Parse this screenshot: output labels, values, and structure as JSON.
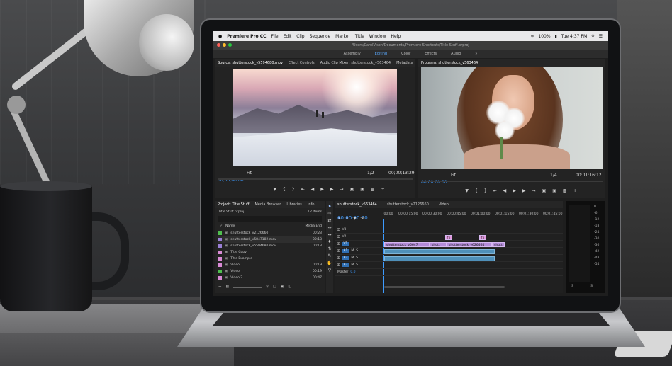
{
  "menubar": {
    "app_name": "Premiere Pro CC",
    "items": [
      "File",
      "Edit",
      "Clip",
      "Sequence",
      "Marker",
      "Title",
      "Window",
      "Help"
    ],
    "battery": "100%",
    "clock": "Tue 4:37 PM"
  },
  "window": {
    "path": "/Users/CarolVison/Documents/Premiere Shortcuts/Title Stuff.prproj"
  },
  "workspaces": {
    "items": [
      "Assembly",
      "Editing",
      "Color",
      "Effects",
      "Audio"
    ],
    "active": "Editing"
  },
  "source_panel": {
    "tabs": [
      "Source: shutterstock_v5594680.mov",
      "Effect Controls",
      "Audio Clip Mixer: shutterstock_v563464",
      "Metadata"
    ],
    "timecode_in": "00;00;00;00",
    "fit": "Fit",
    "scale": "1/2",
    "timecode_out": "00;00;13;29"
  },
  "program_panel": {
    "tab": "Program: shutterstock_v563464",
    "timecode_in": "00:00:00:00",
    "fit": "Fit",
    "scale": "1/4",
    "timecode_out": "00:01:16:12"
  },
  "project_panel": {
    "tabs": [
      "Project: Title Stuff",
      "Media Browser",
      "Libraries",
      "Info"
    ],
    "file": "Title Stuff.prproj",
    "count": "12 Items",
    "columns": [
      "Name",
      "Media End"
    ],
    "rows": [
      {
        "name": "shutterstock_v2126660",
        "time": "00:23",
        "color": "#4fbf4f"
      },
      {
        "name": "shutterstock_v5847182.mov",
        "time": "00:13",
        "color": "#9a7fd6"
      },
      {
        "name": "shutterstock_v5594680.mov",
        "time": "00:13",
        "color": "#9a7fd6"
      },
      {
        "name": "Title Copy",
        "time": "",
        "color": "#d98ad6"
      },
      {
        "name": "Title Example",
        "time": "",
        "color": "#d98ad6"
      },
      {
        "name": "Video",
        "time": "00:19",
        "color": "#d98ad6"
      },
      {
        "name": "Video",
        "time": "00:19",
        "color": "#4fbf4f"
      },
      {
        "name": "Video 2",
        "time": "00:47",
        "color": "#d98ad6"
      }
    ]
  },
  "timeline": {
    "tabs": [
      "shutterstock_v563464",
      "shutterstock_v2126660",
      "Video"
    ],
    "timecode": "00:00:00:00",
    "ruler": [
      ":00:00",
      "00:00:15:00",
      "00:00:30:00",
      "00:00:45:00",
      "00:01:00:00",
      "00:01:15:00",
      "00:01:30:00",
      "00:01:45:00"
    ],
    "tracks": [
      "V3",
      "V2",
      "V1",
      "A1",
      "A2",
      "A3",
      "Master"
    ],
    "master_value": "0.0",
    "clips": [
      "shutterstock_v5647",
      "shutt",
      "shutterstock_v626464",
      "shutt"
    ],
    "fx_marks": [
      "fx",
      "fx"
    ]
  },
  "meters": {
    "scale": [
      "0",
      "-6",
      "-12",
      "-18",
      "-24",
      "-30",
      "-36",
      "-42",
      "-48",
      "-54"
    ],
    "footer": [
      "S",
      "S"
    ]
  }
}
